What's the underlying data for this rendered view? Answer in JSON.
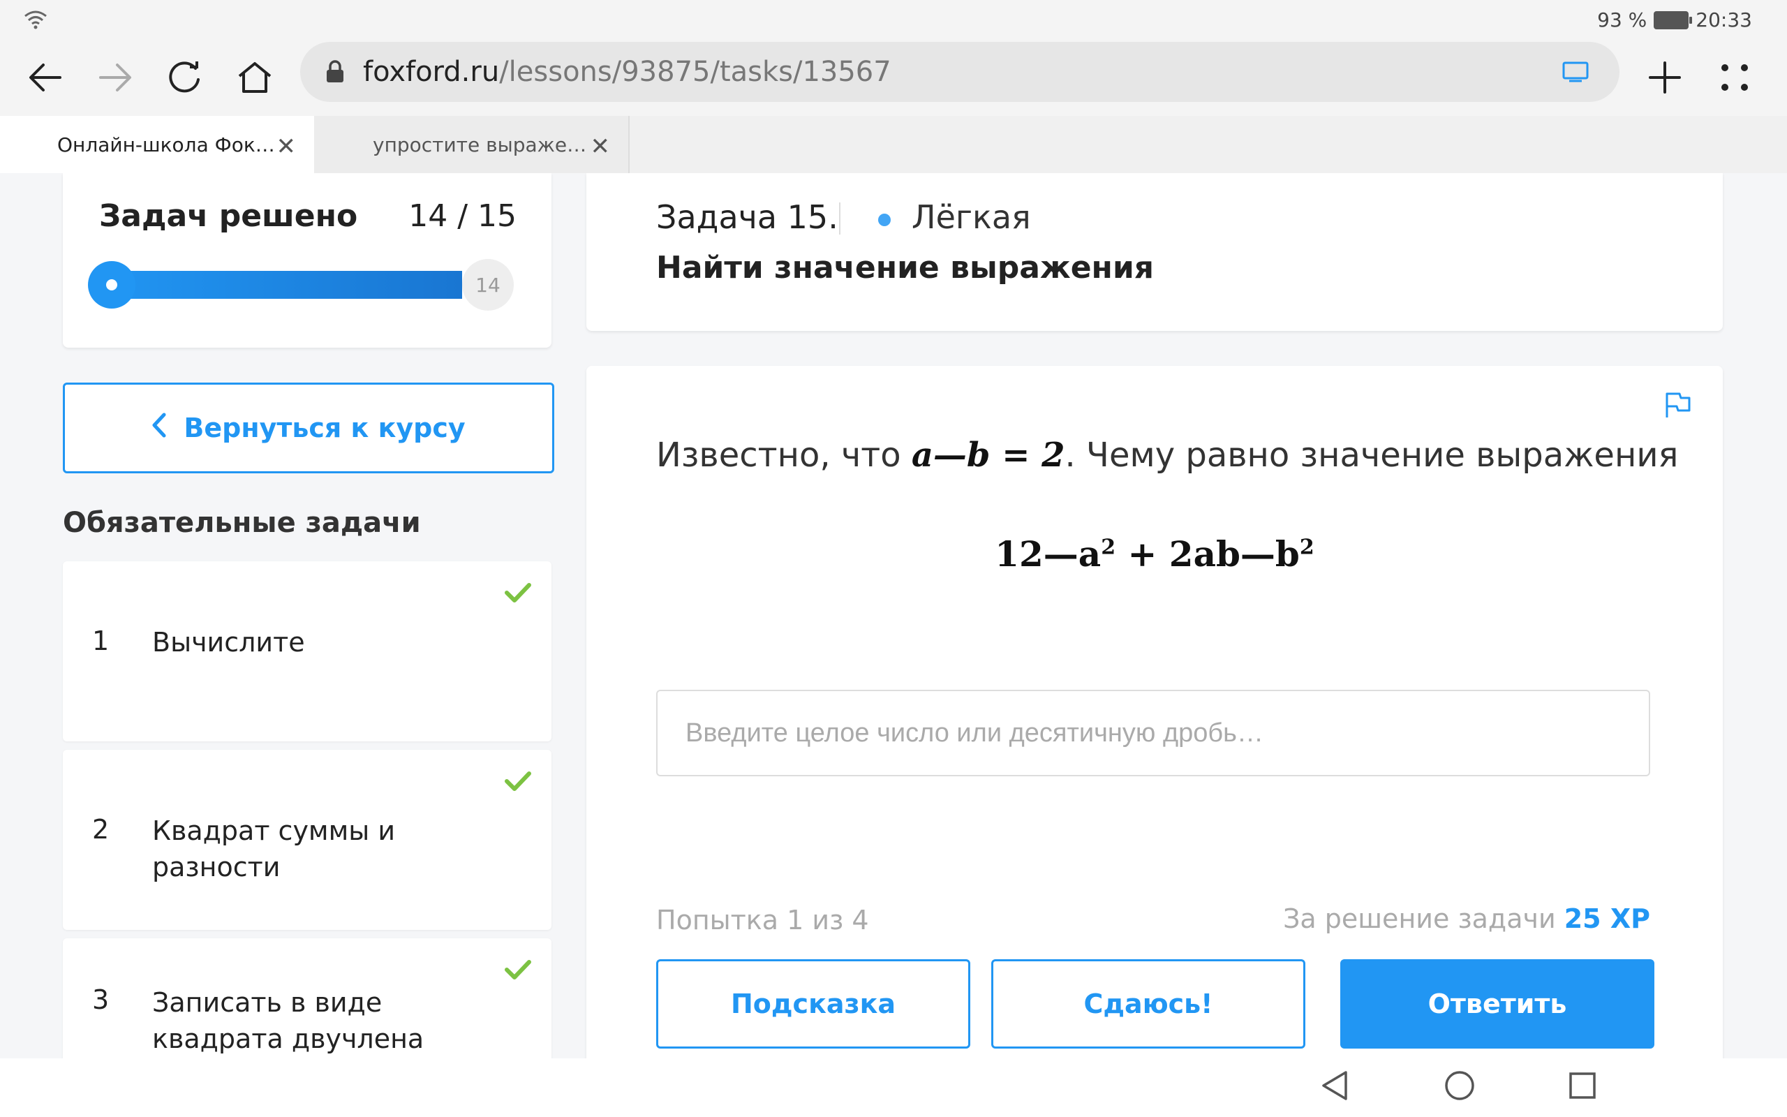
{
  "status_bar": {
    "battery": "93 %",
    "time": "20:33"
  },
  "browser": {
    "url_domain": "foxford.ru",
    "url_path": "/lessons/93875/tasks/13567",
    "tabs": [
      {
        "title": "Онлайн-школа Фок…"
      },
      {
        "title": "упростите выраже…"
      }
    ]
  },
  "progress": {
    "title": "Задач решено",
    "count": "14 / 15",
    "solved": 14,
    "total": 15,
    "badge": "14"
  },
  "sidebar": {
    "back_label": "Вернуться к курсу",
    "section_title": "Обязательные задачи",
    "tasks": [
      {
        "num": "1",
        "label": "Вычислите"
      },
      {
        "num": "2",
        "label": "Квадрат суммы и разности"
      },
      {
        "num": "3",
        "label": "Записать в виде квадрата двучлена"
      }
    ]
  },
  "task": {
    "number": "Задача 15.",
    "level": "Лёгкая",
    "title": "Найти значение выражения",
    "question_prefix": "Известно, что",
    "question_math": "a—b = 2",
    "question_suffix": ". Чему равно значение выражения",
    "formula_a": "12—a",
    "formula_b": " + 2ab—b",
    "exp": "2",
    "input_placeholder": "Введите целое число или десятичную дробь…",
    "attempt": "Попытка 1 из 4",
    "reward_label": "За решение задачи",
    "reward_value": "25 XP",
    "buttons": {
      "hint": "Подсказка",
      "give_up": "Сдаюсь!",
      "answer": "Ответить"
    }
  },
  "colors": {
    "accent": "#2196f3",
    "check": "#7cc242"
  }
}
